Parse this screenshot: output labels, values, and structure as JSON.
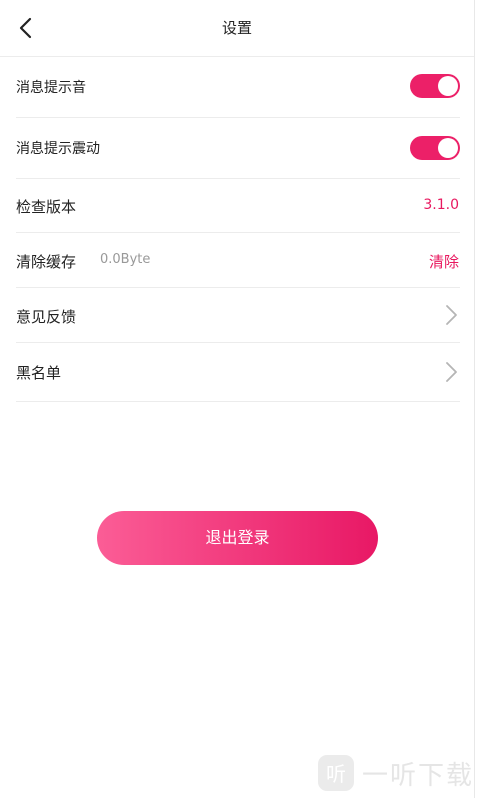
{
  "header": {
    "title": "设置",
    "back_icon": "chevron-left-icon"
  },
  "settings": {
    "sound": {
      "label": "消息提示音",
      "toggle_on": true
    },
    "vibrate": {
      "label": "消息提示震动",
      "toggle_on": true
    },
    "version": {
      "label": "检查版本",
      "value": "3.1.0"
    },
    "cache": {
      "label": "清除缓存",
      "size": "0.0Byte",
      "action": "清除"
    },
    "feedback": {
      "label": "意见反馈",
      "icon": "chevron-right-icon"
    },
    "blacklist": {
      "label": "黑名单",
      "icon": "chevron-right-icon"
    }
  },
  "logout": {
    "label": "退出登录"
  },
  "watermark": {
    "logo_text": "听",
    "text": "一听下载"
  },
  "colors": {
    "accent": "#e8185f",
    "toggle": "#ec2068",
    "gradient_start": "#fb5d96",
    "gradient_end": "#e81865",
    "muted": "#999999",
    "divider": "#ececec"
  }
}
